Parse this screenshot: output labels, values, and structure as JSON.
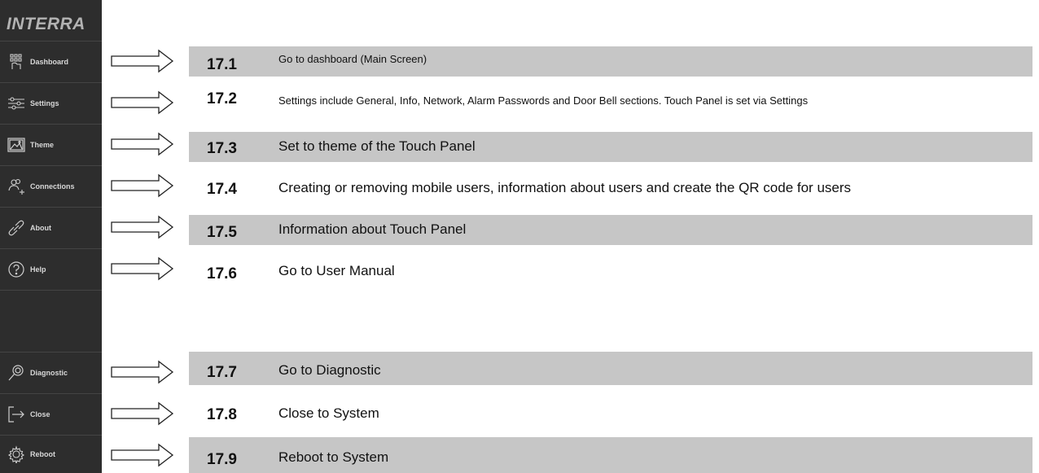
{
  "sidebar": {
    "brand": "INTERRA",
    "items": [
      {
        "label": "Dashboard",
        "icon": "dashboard-grid-icon"
      },
      {
        "label": "Settings",
        "icon": "sliders-icon"
      },
      {
        "label": "Theme",
        "icon": "image-icon"
      },
      {
        "label": "Connections",
        "icon": "users-add-icon"
      },
      {
        "label": "About",
        "icon": "link-icon"
      },
      {
        "label": "Help",
        "icon": "help-circle-icon"
      },
      {
        "label": "Diagnostic",
        "icon": "magnifier-icon"
      },
      {
        "label": "Close",
        "icon": "exit-icon"
      },
      {
        "label": "Reboot",
        "icon": "reboot-gear-icon"
      }
    ]
  },
  "rows": [
    {
      "num": "17.1",
      "text": "Go to dashboard (Main Screen)"
    },
    {
      "num": "17.2",
      "text": "Settings include General, Info, Network, Alarm Passwords and Door Bell sections. Touch Panel is set via Settings"
    },
    {
      "num": "17.3",
      "text": "Set to theme of the Touch Panel"
    },
    {
      "num": "17.4",
      "text": "Creating or removing mobile users, information about users and create the QR code for users"
    },
    {
      "num": "17.5",
      "text": "Information about Touch Panel"
    },
    {
      "num": "17.6",
      "text": "Go to User Manual"
    },
    {
      "num": "17.7",
      "text": "Go to Diagnostic"
    },
    {
      "num": "17.8",
      "text": "Close to System"
    },
    {
      "num": "17.9",
      "text": "Reboot to System"
    }
  ],
  "colors": {
    "sidebar": "#2d2d2d",
    "row_shade": "#c6c6c6",
    "arrow": "#222222"
  }
}
